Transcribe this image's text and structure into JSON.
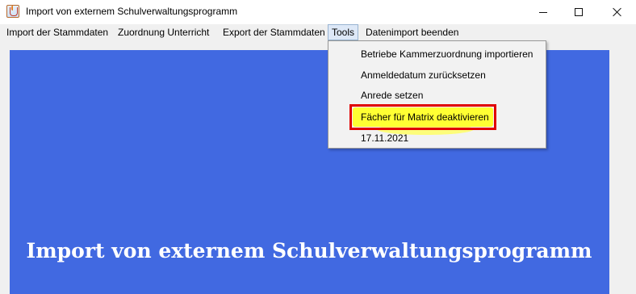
{
  "window": {
    "title": "Import von externem Schulverwaltungsprogramm"
  },
  "menubar": {
    "items": [
      {
        "label": "Import der Stammdaten"
      },
      {
        "label": "Zuordnung Unterricht"
      },
      {
        "label": "Export der Stammdaten"
      },
      {
        "label": "Tools"
      },
      {
        "label": "Datenimport beenden"
      }
    ]
  },
  "tools_menu": {
    "items": [
      {
        "label": "Betriebe Kammerzuordnung importieren"
      },
      {
        "label": "Anmeldedatum zurücksetzen"
      },
      {
        "label": "Anrede setzen"
      },
      {
        "label": "Fächer für Matrix deaktivieren"
      },
      {
        "label": "17.11.2021"
      }
    ]
  },
  "main": {
    "heading": "Import von externem Schulverwaltungsprogramm"
  },
  "colors": {
    "panel_blue": "#4169e1",
    "highlight_border": "#e00000",
    "highlight_fill": "#ffff33"
  }
}
